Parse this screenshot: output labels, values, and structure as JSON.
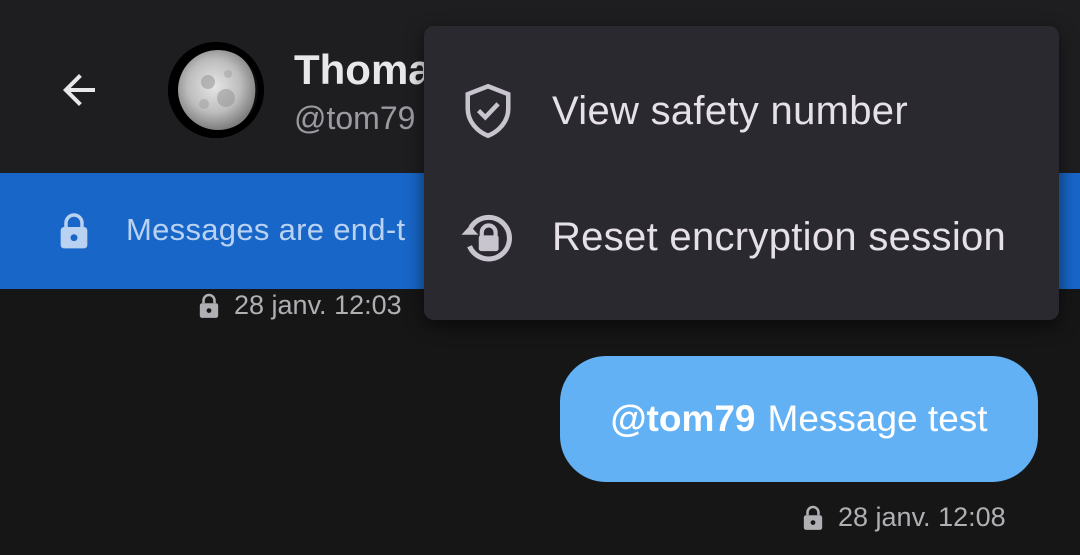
{
  "header": {
    "contact_name": "Thoma",
    "contact_handle": "@tom79"
  },
  "banner": {
    "text": "Messages are end-t"
  },
  "messages": [
    {
      "timestamp": "28 janv. 12:03"
    },
    {
      "mention": "@tom79",
      "body": "Message test",
      "timestamp": "28 janv. 12:08"
    }
  ],
  "menu": {
    "items": [
      {
        "label": "View safety number",
        "icon": "shield-check-icon"
      },
      {
        "label": "Reset encryption session",
        "icon": "reset-lock-icon"
      }
    ]
  },
  "colors": {
    "banner": "#1866c8",
    "bubble": "#62b1f4",
    "menu_bg": "#2b2930",
    "background": "#161616"
  }
}
